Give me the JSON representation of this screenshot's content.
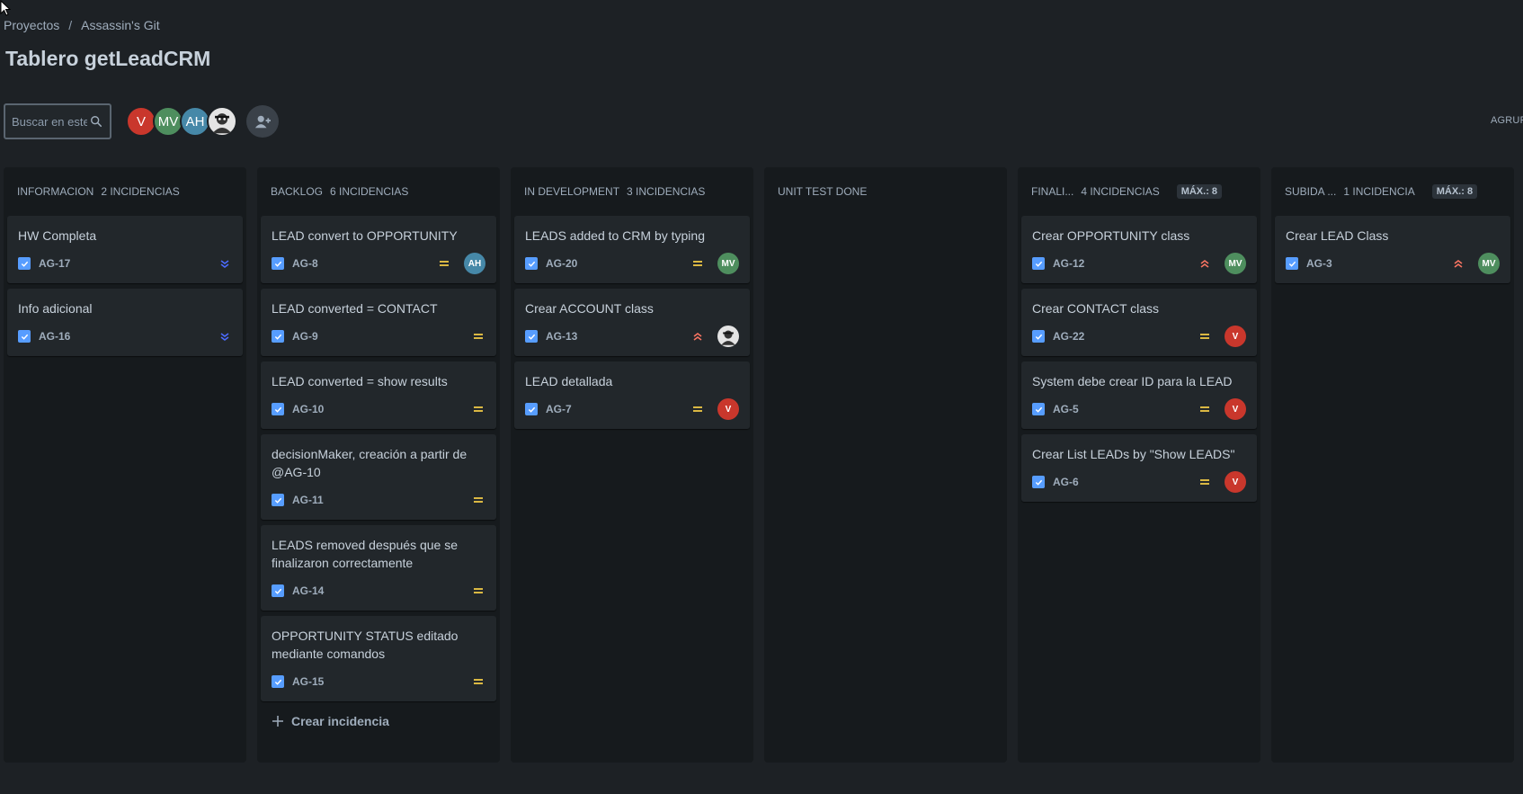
{
  "breadcrumb": {
    "projects": "Proyectos",
    "separator": "/",
    "project": "Assassin's Git"
  },
  "page_title": "Tablero getLeadCRM",
  "search": {
    "placeholder": "Buscar en este tablero",
    "value": ""
  },
  "toolbar": {
    "avatars": [
      {
        "initials": "V",
        "color": "#c9372c"
      },
      {
        "initials": "MV",
        "color": "#4e8e5e"
      },
      {
        "initials": "AH",
        "color": "#4688a8"
      },
      {
        "initials": "",
        "color": "#dcdcdc",
        "icon": "photo-avatar"
      }
    ],
    "add_people_icon": "person-add-icon",
    "group_by_label": "AGRUPAR POR"
  },
  "colors": {
    "priority_low": "#4c6bff",
    "priority_medium": "#f5cd47",
    "priority_high": "#f87462",
    "checkbox": "#579dff"
  },
  "columns": [
    {
      "name": "INFORMACION",
      "count": "2 INCIDENCIAS",
      "limit": "",
      "cards": [
        {
          "title": "HW Completa",
          "key": "AG-17",
          "priority": "lowest",
          "assignee": ""
        },
        {
          "title": "Info adicional",
          "key": "AG-16",
          "priority": "lowest",
          "assignee": ""
        }
      ]
    },
    {
      "name": "BACKLOG",
      "count": "6 INCIDENCIAS",
      "limit": "",
      "create_label": "Crear incidencia",
      "cards": [
        {
          "title": "LEAD convert to OPPORTUNITY",
          "key": "AG-8",
          "priority": "medium",
          "assignee": "AH"
        },
        {
          "title": "LEAD converted = CONTACT",
          "key": "AG-9",
          "priority": "medium",
          "assignee": ""
        },
        {
          "title": "LEAD converted = show results",
          "key": "AG-10",
          "priority": "medium",
          "assignee": ""
        },
        {
          "title": "decisionMaker, creación a partir de @AG-10",
          "key": "AG-11",
          "priority": "medium",
          "assignee": ""
        },
        {
          "title": "LEADS removed después que se finalizaron correctamente",
          "key": "AG-14",
          "priority": "medium",
          "assignee": ""
        },
        {
          "title": "OPPORTUNITY STATUS editado mediante comandos",
          "key": "AG-15",
          "priority": "medium",
          "assignee": ""
        }
      ]
    },
    {
      "name": "IN DEVELOPMENT",
      "count": "3 INCIDENCIAS",
      "limit": "",
      "cards": [
        {
          "title": "LEADS added to CRM by typing",
          "key": "AG-20",
          "priority": "medium",
          "assignee": "MV"
        },
        {
          "title": "Crear ACCOUNT class",
          "key": "AG-13",
          "priority": "high",
          "assignee": "photo"
        },
        {
          "title": "LEAD detallada",
          "key": "AG-7",
          "priority": "medium",
          "assignee": "V"
        }
      ]
    },
    {
      "name": "UNIT TEST DONE",
      "count": "",
      "limit": "",
      "cards": []
    },
    {
      "name": "FINALI...",
      "count": "4 INCIDENCIAS",
      "limit": "MÁX.: 8",
      "cards": [
        {
          "title": "Crear OPPORTUNITY class",
          "key": "AG-12",
          "priority": "high",
          "assignee": "MV"
        },
        {
          "title": "Crear CONTACT class",
          "key": "AG-22",
          "priority": "medium",
          "assignee": "V"
        },
        {
          "title": "System debe crear ID para la LEAD",
          "key": "AG-5",
          "priority": "medium",
          "assignee": "V"
        },
        {
          "title": "Crear List LEADs by \"Show LEADS\"",
          "key": "AG-6",
          "priority": "medium",
          "assignee": "V"
        }
      ]
    },
    {
      "name": "SUBIDA ...",
      "count": "1 INCIDENCIA",
      "limit": "MÁX.: 8",
      "cards": [
        {
          "title": "Crear LEAD Class",
          "key": "AG-3",
          "priority": "high",
          "assignee": "MV"
        }
      ]
    }
  ],
  "assignee_colors": {
    "V": "#c9372c",
    "MV": "#4e8e5e",
    "AH": "#4688a8",
    "photo": "#dcdcdc"
  }
}
